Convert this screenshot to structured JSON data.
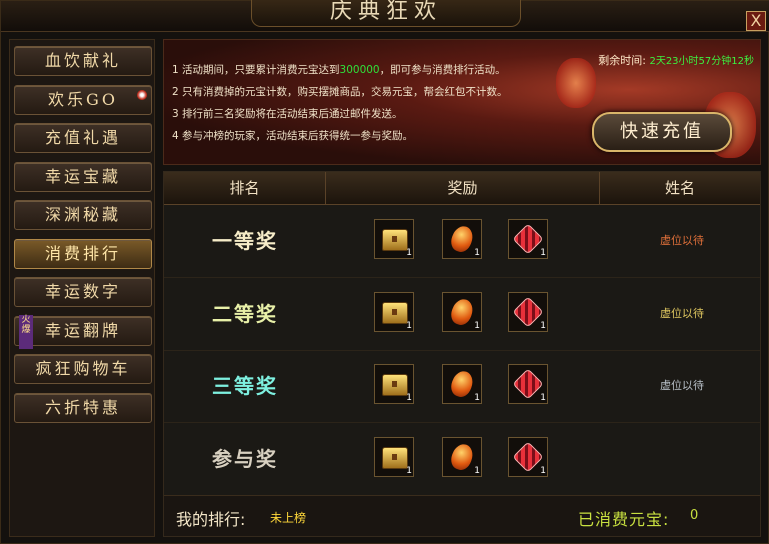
{
  "window": {
    "title": "庆典狂欢",
    "close_label": "X"
  },
  "sidebar": {
    "items": [
      {
        "label": "血饮献礼"
      },
      {
        "label": "欢乐GO",
        "badge": true
      },
      {
        "label": "充值礼遇"
      },
      {
        "label": "幸运宝藏"
      },
      {
        "label": "深渊秘藏"
      },
      {
        "label": "消费排行",
        "active": true
      },
      {
        "label": "幸运数字"
      },
      {
        "label": "幸运翻牌",
        "tag": "火爆"
      },
      {
        "label": "疯狂购物车"
      },
      {
        "label": "六折特惠"
      }
    ]
  },
  "banner": {
    "rules": [
      {
        "prefix": "1  活动期间，只要累计消费元宝达到",
        "highlight": "300000",
        "suffix": "，即可参与消费排行活动。"
      },
      {
        "prefix": "2  只有消费掉的元宝计数，购买摆摊商品，交易元宝，帮会红包不计数。",
        "highlight": "",
        "suffix": ""
      },
      {
        "prefix": "3  排行前三名奖励将在活动结束后通过邮件发送。",
        "highlight": "",
        "suffix": ""
      },
      {
        "prefix": "4  参与冲榜的玩家，活动结束后获得统一参与奖励。",
        "highlight": "",
        "suffix": ""
      }
    ],
    "remaining_label": "剩余时间:",
    "remaining_value": "2天23小时57分钟12秒",
    "recharge_label": "快速充值"
  },
  "table": {
    "headers": [
      "排名",
      "奖励",
      "姓名"
    ],
    "rows": [
      {
        "rank": "一等奖",
        "rank_color": "#f6ecc8",
        "name": "虚位以待",
        "name_color": "#e0703a",
        "rewards": [
          {
            "icon": "treasure-chest-icon",
            "count": "1"
          },
          {
            "icon": "fire-gem-icon",
            "count": "1"
          },
          {
            "icon": "crystal-orb-icon",
            "count": "1"
          }
        ]
      },
      {
        "rank": "二等奖",
        "rank_color": "#e8f0a8",
        "name": "虚位以待",
        "name_color": "#e0c860",
        "rewards": [
          {
            "icon": "treasure-chest-icon",
            "count": "1"
          },
          {
            "icon": "fire-gem-icon",
            "count": "1"
          },
          {
            "icon": "crystal-orb-icon",
            "count": "1"
          }
        ]
      },
      {
        "rank": "三等奖",
        "rank_color": "#7ef0e0",
        "name": "虚位以待",
        "name_color": "#b8c0c8",
        "rewards": [
          {
            "icon": "golden-chest-icon",
            "count": "1"
          },
          {
            "icon": "fire-gem-icon",
            "count": "1"
          },
          {
            "icon": "crystal-orb-icon",
            "count": "1"
          }
        ]
      },
      {
        "rank": "参与奖",
        "rank_color": "#d8d0c0",
        "name": "",
        "name_color": "#b8c0c8",
        "rewards": [
          {
            "icon": "golden-chest-icon",
            "count": "1"
          },
          {
            "icon": "fire-gem-icon",
            "count": "1"
          },
          {
            "icon": "crystal-orb-icon",
            "count": "1"
          }
        ]
      }
    ]
  },
  "footer": {
    "my_rank_label": "我的排行:",
    "my_rank_value": "未上榜",
    "spent_label": "已消费元宝:",
    "spent_value": "0"
  }
}
